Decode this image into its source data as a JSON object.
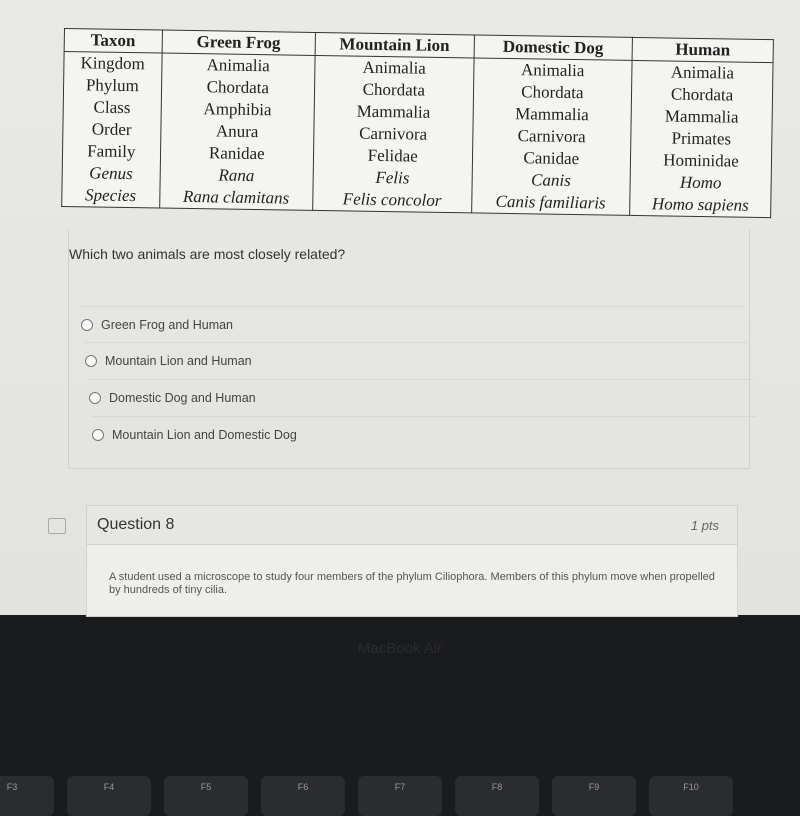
{
  "table": {
    "headers": [
      "Taxon",
      "Green Frog",
      "Mountain Lion",
      "Domestic Dog",
      "Human"
    ],
    "rows": [
      [
        "Kingdom",
        "Animalia",
        "Animalia",
        "Animalia",
        "Animalia"
      ],
      [
        "Phylum",
        "Chordata",
        "Chordata",
        "Chordata",
        "Chordata"
      ],
      [
        "Class",
        "Amphibia",
        "Mammalia",
        "Mammalia",
        "Mammalia"
      ],
      [
        "Order",
        "Anura",
        "Carnivora",
        "Carnivora",
        "Primates"
      ],
      [
        "Family",
        "Ranidae",
        "Felidae",
        "Canidae",
        "Hominidae"
      ],
      [
        "Genus",
        "Rana",
        "Felis",
        "Canis",
        "Homo"
      ],
      [
        "Species",
        "Rana clamitans",
        "Felis concolor",
        "Canis familiaris",
        "Homo sapiens"
      ]
    ]
  },
  "question7": {
    "text": "Which two animals are most closely related?",
    "answers": [
      "Green Frog and Human",
      "Mountain Lion and Human",
      "Domestic Dog and Human",
      "Mountain Lion and Domestic Dog"
    ]
  },
  "question8": {
    "title": "Question 8",
    "points": "1 pts",
    "text": "A student used a microscope to study four members of the phylum Ciliophora. Members of this phylum move when propelled by hundreds of tiny cilia."
  },
  "laptop": {
    "brand": "MacBook Air",
    "keys": [
      "F3",
      "F4",
      "F5",
      "F6",
      "F7",
      "F8",
      "F9",
      "F10"
    ]
  }
}
